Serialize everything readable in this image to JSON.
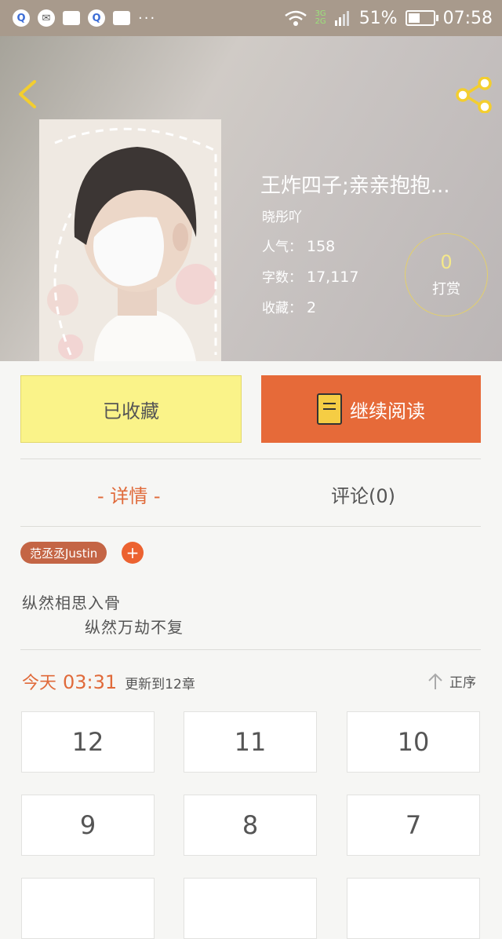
{
  "status_bar": {
    "battery": "51%",
    "battery_fraction": 0.51,
    "time": "07:58",
    "net_top": "3G",
    "net_bottom": "2G",
    "more": "···"
  },
  "book": {
    "title": "王炸四子;亲亲抱抱...",
    "author": "晓彤吖",
    "stats": {
      "popularity_label": "人气：",
      "popularity": "158",
      "words_label": "字数：",
      "words": "17,117",
      "favorites_label": "收藏：",
      "favorites": "2"
    },
    "tip_count": "0",
    "tip_label": "打赏"
  },
  "actions": {
    "favorited_label": "已收藏",
    "continue_label": "继续阅读"
  },
  "tabs": {
    "detail": "- 详情 -",
    "comments": "评论(0)"
  },
  "tag": {
    "label": "范丞丞Justin",
    "add": "+"
  },
  "intro": {
    "line1": "纵然相思入骨",
    "line2": "纵然万劫不复"
  },
  "update": {
    "day": "今天",
    "time": "03:31",
    "text": "更新到12章",
    "sort_label": "正序"
  },
  "chapters": [
    "12",
    "11",
    "10",
    "9",
    "8",
    "7"
  ],
  "colors": {
    "accent": "#e66a39",
    "favorite_button": "#faf389",
    "tag": "#c46545"
  }
}
